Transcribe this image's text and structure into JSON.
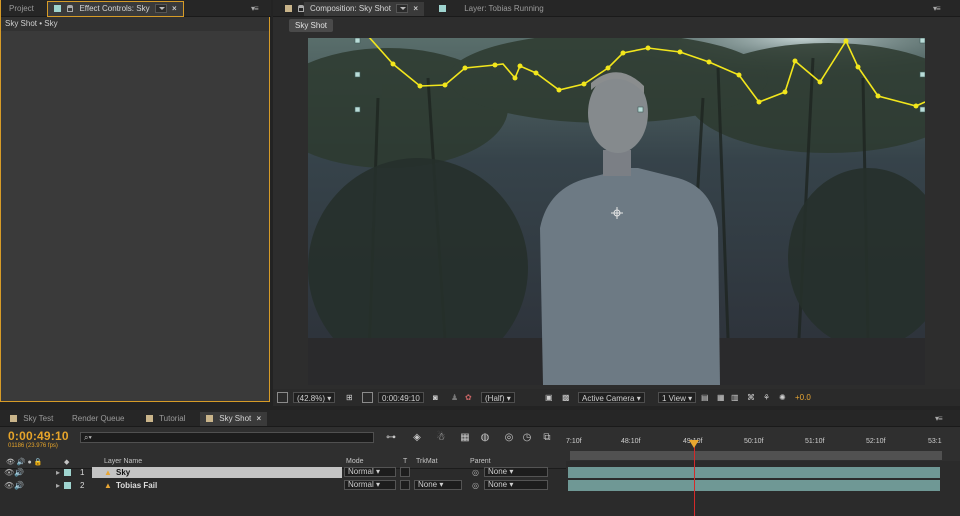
{
  "left_panel": {
    "tab_project": "Project",
    "tab_effect_controls": "Effect Controls: Sky",
    "subtitle": "Sky Shot • Sky"
  },
  "comp_panel": {
    "tab_composition": "Composition: Sky Shot",
    "tab_layer": "Layer: Tobias Running",
    "breadcrumb": "Sky Shot"
  },
  "comp_toolbar": {
    "zoom": "(42.8%)",
    "timecode": "0:00:49:10",
    "resolution": "(Half)",
    "camera": "Active Camera",
    "views": "1 View",
    "exposure": "+0.0"
  },
  "timeline_tabs": [
    "Sky Test",
    "Render Queue",
    "Tutorial",
    "Sky Shot"
  ],
  "timeline": {
    "timecode": "0:00:49:10",
    "frame_info": "01186 (23.976 fps)",
    "search_placeholder": "⌕▾",
    "columns": {
      "layer_name": "Layer Name",
      "mode": "Mode",
      "t": "T",
      "trkmat": "TrkMat",
      "parent": "Parent"
    },
    "ruler_ticks": [
      "7:10f",
      "48:10f",
      "49:10f",
      "50:10f",
      "51:10f",
      "52:10f",
      "53:1"
    ],
    "layers": [
      {
        "num": "1",
        "name": "Sky",
        "mode": "Normal",
        "trkmat": "",
        "parent": "None"
      },
      {
        "num": "2",
        "name": "Tobias Fail",
        "mode": "Normal",
        "trkmat": "None",
        "parent": "None"
      }
    ]
  },
  "colors": {
    "accent": "#d69b27",
    "timecode": "#e6a42a",
    "layer_bar": "#6f9895",
    "mask_path": "#f2e61c",
    "playhead": "#d42a2a"
  }
}
